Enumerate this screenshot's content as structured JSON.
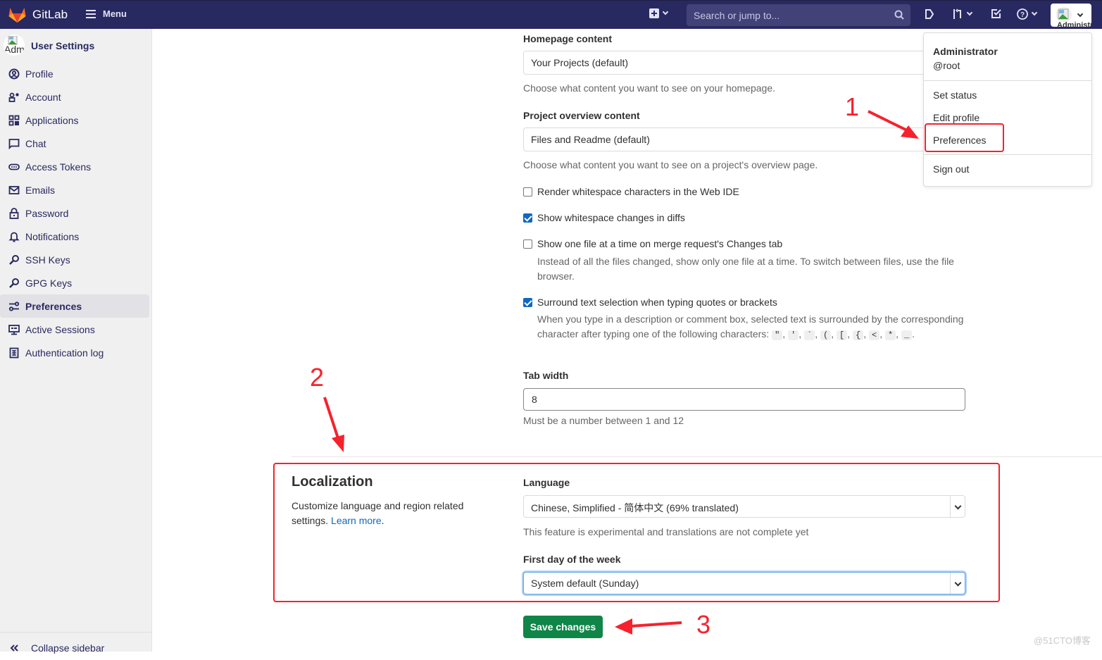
{
  "topbar": {
    "brand": "GitLab",
    "menu_label": "Menu",
    "search_placeholder": "Search or jump to...",
    "avatar_alt": "Administrator",
    "icons": [
      "plus-square-icon",
      "issues-icon",
      "merge-request-icon",
      "todo-icon",
      "help-icon"
    ]
  },
  "sidebar": {
    "title": "User Settings",
    "avatar_alt": "Adm",
    "items": [
      {
        "label": "Profile",
        "icon": "profile-icon"
      },
      {
        "label": "Account",
        "icon": "account-icon"
      },
      {
        "label": "Applications",
        "icon": "applications-icon"
      },
      {
        "label": "Chat",
        "icon": "chat-icon"
      },
      {
        "label": "Access Tokens",
        "icon": "token-icon"
      },
      {
        "label": "Emails",
        "icon": "mail-icon"
      },
      {
        "label": "Password",
        "icon": "lock-icon"
      },
      {
        "label": "Notifications",
        "icon": "bell-icon"
      },
      {
        "label": "SSH Keys",
        "icon": "key-icon"
      },
      {
        "label": "GPG Keys",
        "icon": "key-icon"
      },
      {
        "label": "Preferences",
        "icon": "preferences-icon",
        "active": true
      },
      {
        "label": "Active Sessions",
        "icon": "monitor-icon"
      },
      {
        "label": "Authentication log",
        "icon": "log-icon"
      }
    ],
    "collapse_label": "Collapse sidebar"
  },
  "behavior": {
    "homepage_label": "Homepage content",
    "homepage_value": "Your Projects (default)",
    "homepage_help": "Choose what content you want to see on your homepage.",
    "overview_label": "Project overview content",
    "overview_value": "Files and Readme (default)",
    "overview_help": "Choose what content you want to see on a project's overview page.",
    "checkboxes": [
      {
        "label": "Render whitespace characters in the Web IDE",
        "checked": false
      },
      {
        "label": "Show whitespace changes in diffs",
        "checked": true
      },
      {
        "label": "Show one file at a time on merge request's Changes tab",
        "checked": false,
        "help": "Instead of all the files changed, show only one file at a time. To switch between files, use the file browser."
      },
      {
        "label": "Surround text selection when typing quotes or brackets",
        "checked": true,
        "help": "When you type in a description or comment box, selected text is surrounded by the corresponding character after typing one of the following characters:"
      }
    ],
    "surround_chars": [
      "\"",
      "'",
      "`",
      "(",
      "[",
      "{",
      "<",
      "*",
      "_"
    ],
    "tab_width_label": "Tab width",
    "tab_width_value": "8",
    "tab_width_help": "Must be a number between 1 and 12"
  },
  "localization": {
    "title": "Localization",
    "description": "Customize language and region related settings.",
    "learn_more": "Learn more",
    "language_label": "Language",
    "language_value": "Chinese, Simplified - 简体中文 (69% translated)",
    "language_help": "This feature is experimental and translations are not complete yet",
    "first_day_label": "First day of the week",
    "first_day_value": "System default (Sunday)"
  },
  "save_button": "Save changes",
  "user_dropdown": {
    "name": "Administrator",
    "username": "@root",
    "items": [
      "Set status",
      "Edit profile",
      "Preferences",
      "Sign out"
    ]
  },
  "annotations": {
    "step1": "1",
    "step2": "2",
    "step3": "3",
    "color": "#f5222d"
  },
  "watermark": "@51CTO博客"
}
